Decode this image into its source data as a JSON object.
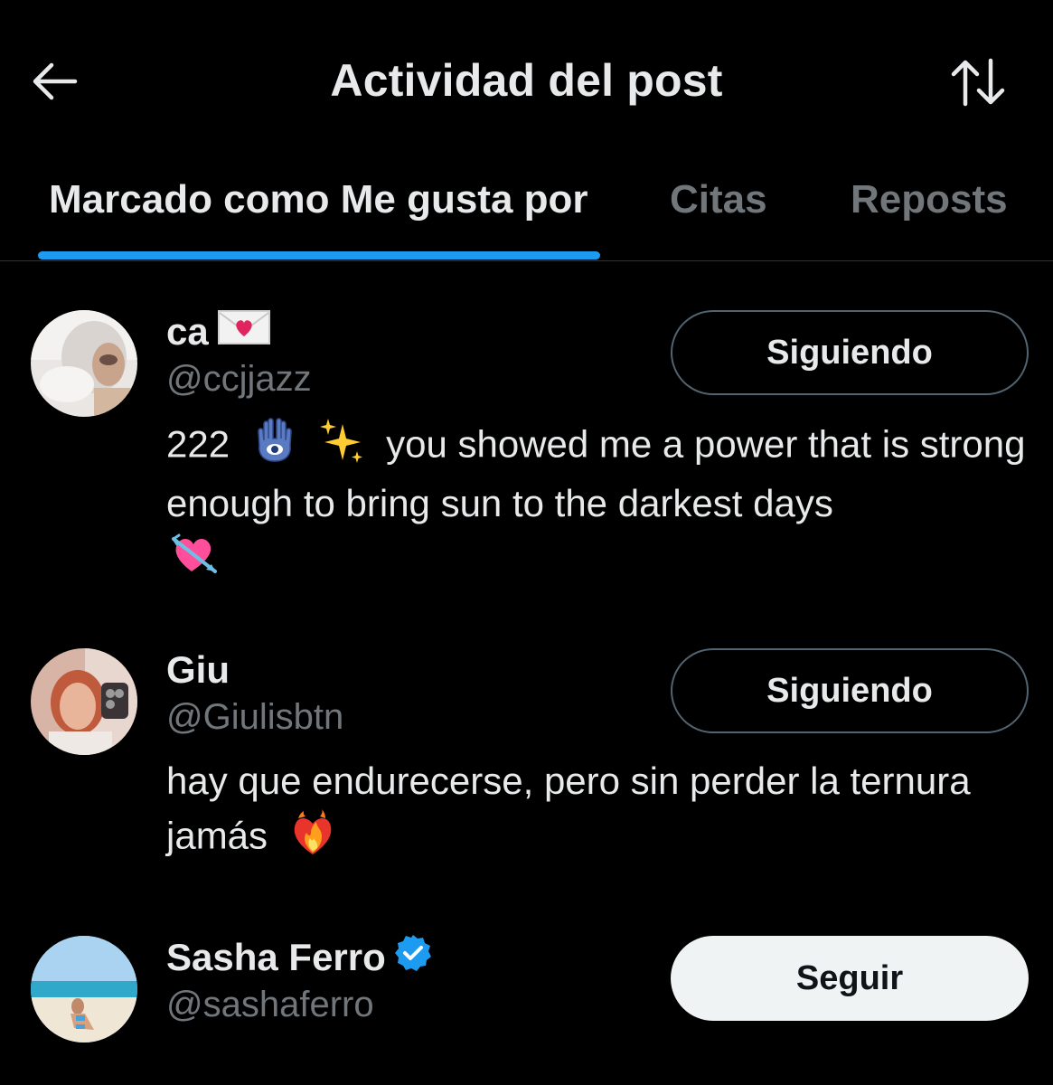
{
  "header": {
    "title": "Actividad del post",
    "back_icon": "arrow-left-icon",
    "sort_icon": "sort-arrows-icon"
  },
  "tabs": [
    {
      "label": "Marcado como Me gusta por",
      "active": true
    },
    {
      "label": "Citas",
      "active": false
    },
    {
      "label": "Reposts",
      "active": false
    }
  ],
  "colors": {
    "accent": "#1d9bf0",
    "background": "#000000",
    "muted_text": "#71767b",
    "verified": "#1d9bf0"
  },
  "users": [
    {
      "name": "ca",
      "name_emoji": "love-letter-icon",
      "handle": "@ccjjazz",
      "bio_parts": [
        "222",
        "you showed me a power that is strong enough to bring sun to the darkest days"
      ],
      "bio_emojis": [
        "hamsa-icon",
        "sparkles-icon",
        "heart-with-arrow-icon"
      ],
      "button_label": "Siguiendo",
      "verified": false
    },
    {
      "name": "Giu",
      "handle": "@Giulisbtn",
      "bio_parts": [
        "hay que endurecerse, pero sin perder la ternura jamás"
      ],
      "bio_emojis": [
        "heart-on-fire-icon"
      ],
      "button_label": "Siguiendo",
      "verified": false
    },
    {
      "name": "Sasha Ferro",
      "handle": "@sashaferro",
      "button_label": "Seguir",
      "verified": true
    }
  ]
}
